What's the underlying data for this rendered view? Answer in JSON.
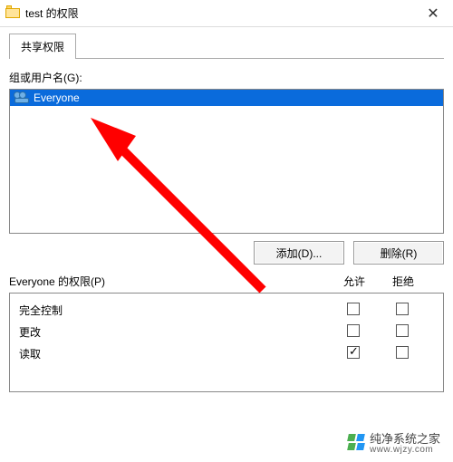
{
  "titlebar": {
    "title": "test 的权限"
  },
  "tabs": {
    "share": "共享权限"
  },
  "labels": {
    "groupsUsers": "组或用户名(G):",
    "addBtn": "添加(D)...",
    "removeBtn": "删除(R)",
    "permFor": "Everyone 的权限(P)",
    "allow": "允许",
    "deny": "拒绝"
  },
  "principals": [
    {
      "name": "Everyone"
    }
  ],
  "permissions": [
    {
      "name": "完全控制",
      "allow": false,
      "deny": false
    },
    {
      "name": "更改",
      "allow": false,
      "deny": false
    },
    {
      "name": "读取",
      "allow": true,
      "deny": false
    }
  ],
  "watermark": {
    "text": "纯净系统之家",
    "url": "www.wjzy.com"
  }
}
